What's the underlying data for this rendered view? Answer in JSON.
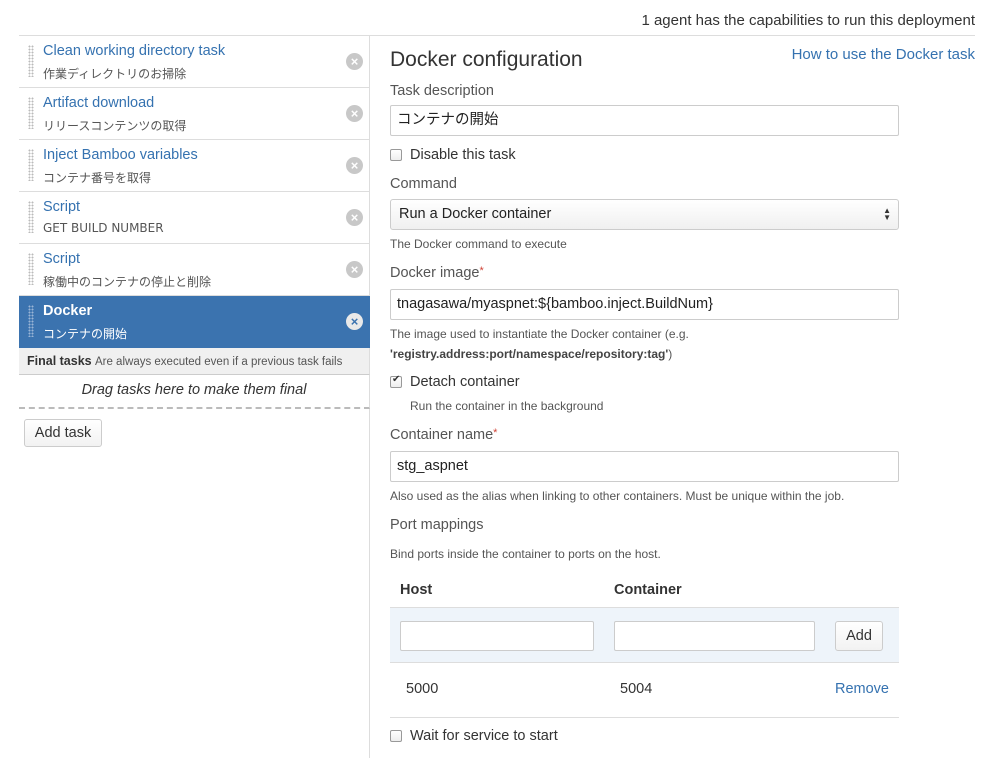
{
  "header": {
    "agents_text": "1 agent has the capabilities to run this deployment"
  },
  "tasks": [
    {
      "name": "Clean working directory task",
      "desc": "作業ディレクトリのお掃除"
    },
    {
      "name": "Artifact download",
      "desc": "リリースコンテンツの取得"
    },
    {
      "name": "Inject Bamboo variables",
      "desc": "コンテナ番号を取得"
    },
    {
      "name": "Script",
      "desc": "GET BUILD NUMBER"
    },
    {
      "name": "Script",
      "desc": "稼働中のコンテナの停止と削除"
    },
    {
      "name": "Docker",
      "desc": "コンテナの開始",
      "selected": true
    }
  ],
  "remove_glyph": "×",
  "final_tasks": {
    "title": "Final tasks",
    "subtitle": "Are always executed even if a previous task fails",
    "drop_text": "Drag tasks here to make them final"
  },
  "add_task_label": "Add task",
  "form": {
    "title": "Docker configuration",
    "help_link": "How to use the Docker task",
    "task_description_label": "Task description",
    "task_description_value": "コンテナの開始",
    "disable_label": "Disable this task",
    "command_label": "Command",
    "command_value": "Run a Docker container",
    "command_hint": "The Docker command to execute",
    "image_label": "Docker image",
    "required_mark": "*",
    "image_value": "tnagasawa/myaspnet:${bamboo.inject.BuildNum}",
    "image_hint_1": "The image used to instantiate the Docker container (e.g.",
    "image_hint_2_bold": "'registry.address:port/namespace/repository:tag'",
    "image_hint_2_tail": ")",
    "detach_label": "Detach container",
    "detach_hint": "Run the container in the background",
    "container_name_label": "Container name",
    "container_name_value": "stg_aspnet",
    "container_name_hint": "Also used as the alias when linking to other containers. Must be unique within the job.",
    "port_mappings_label": "Port mappings",
    "port_mappings_hint": "Bind ports inside the container to ports on the host.",
    "port_table": {
      "col_host": "Host",
      "col_container": "Container",
      "add_label": "Add",
      "rows": [
        {
          "host": "5000",
          "container": "5004",
          "action": "Remove"
        }
      ]
    },
    "wait_label": "Wait for service to start"
  },
  "colors": {
    "link": "#3572b0",
    "selected": "#3b73af",
    "required": "#d04437"
  }
}
